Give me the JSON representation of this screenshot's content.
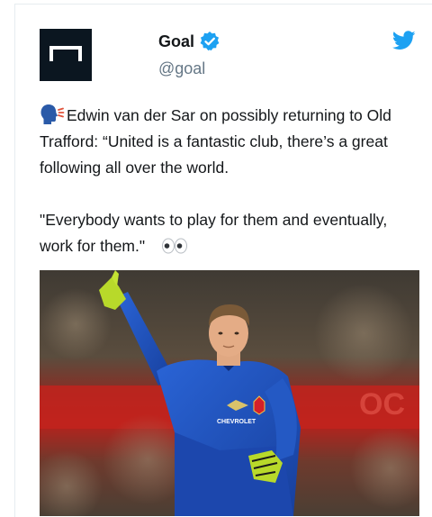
{
  "tweet": {
    "author": {
      "display_name": "Goal",
      "handle": "@goal",
      "avatar_icon": "goal-logo-icon",
      "verified_icon": "verified-badge-icon",
      "verified_color": "#1da1f2"
    },
    "platform_icon": "twitter-bird-icon",
    "text": {
      "line1_emoji": "speaking-head-icon",
      "paragraph1": "Edwin van der Sar on possibly returning to Old Trafford: “United is a fantastic club, there’s a great following all over the world.",
      "paragraph2": "\"Everybody wants to play for them and eventually, work for them.\"",
      "trailing_emoji": "eyes-icon"
    },
    "media": {
      "type": "photo",
      "kit_text": "CHEVROLET"
    }
  },
  "colors": {
    "text": "#14171a",
    "muted": "#657786",
    "twitter_blue": "#1da1f2",
    "jersey_blue": "#1f4fb8"
  }
}
